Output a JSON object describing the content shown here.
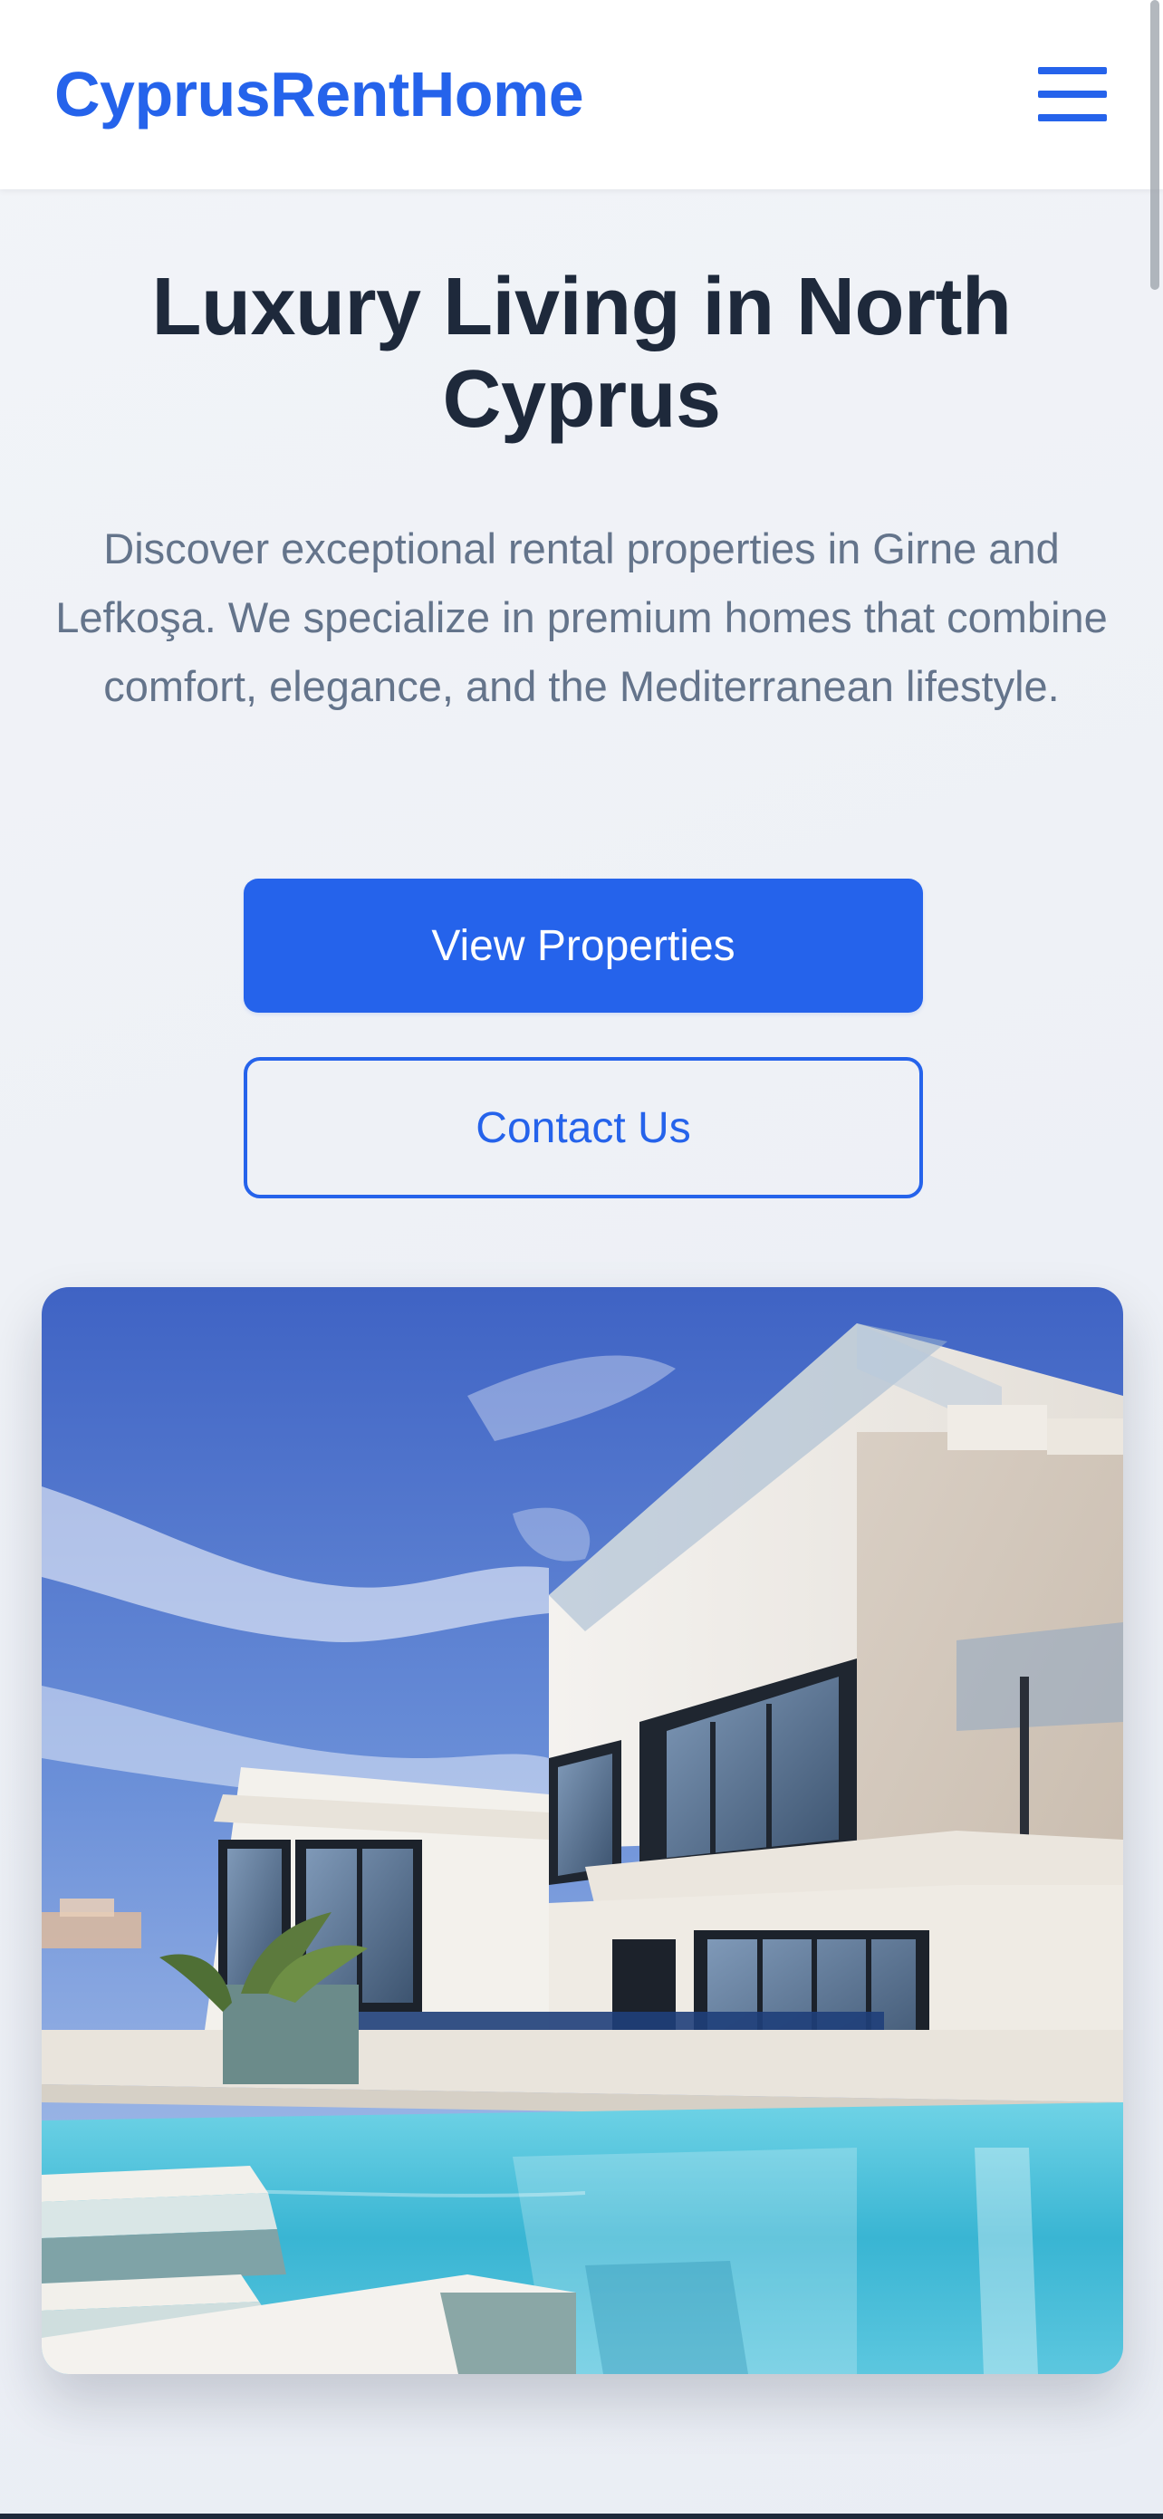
{
  "header": {
    "brand": "CyprusRentHome",
    "menu_icon": "hamburger-menu-icon"
  },
  "hero": {
    "title": "Luxury Living in North Cyprus",
    "description": "Discover exceptional rental properties in Girne and Lefkoşa. We specialize in premium homes that combine comfort, elegance, and the Mediterranean lifestyle.",
    "primary_button": "View Properties",
    "secondary_button": "Contact Us",
    "image_alt": "modern-villa-with-pool-photo"
  },
  "colors": {
    "accent": "#2563eb",
    "heading": "#1e293b",
    "body_text": "#64748b",
    "background": "#eef1f7"
  }
}
